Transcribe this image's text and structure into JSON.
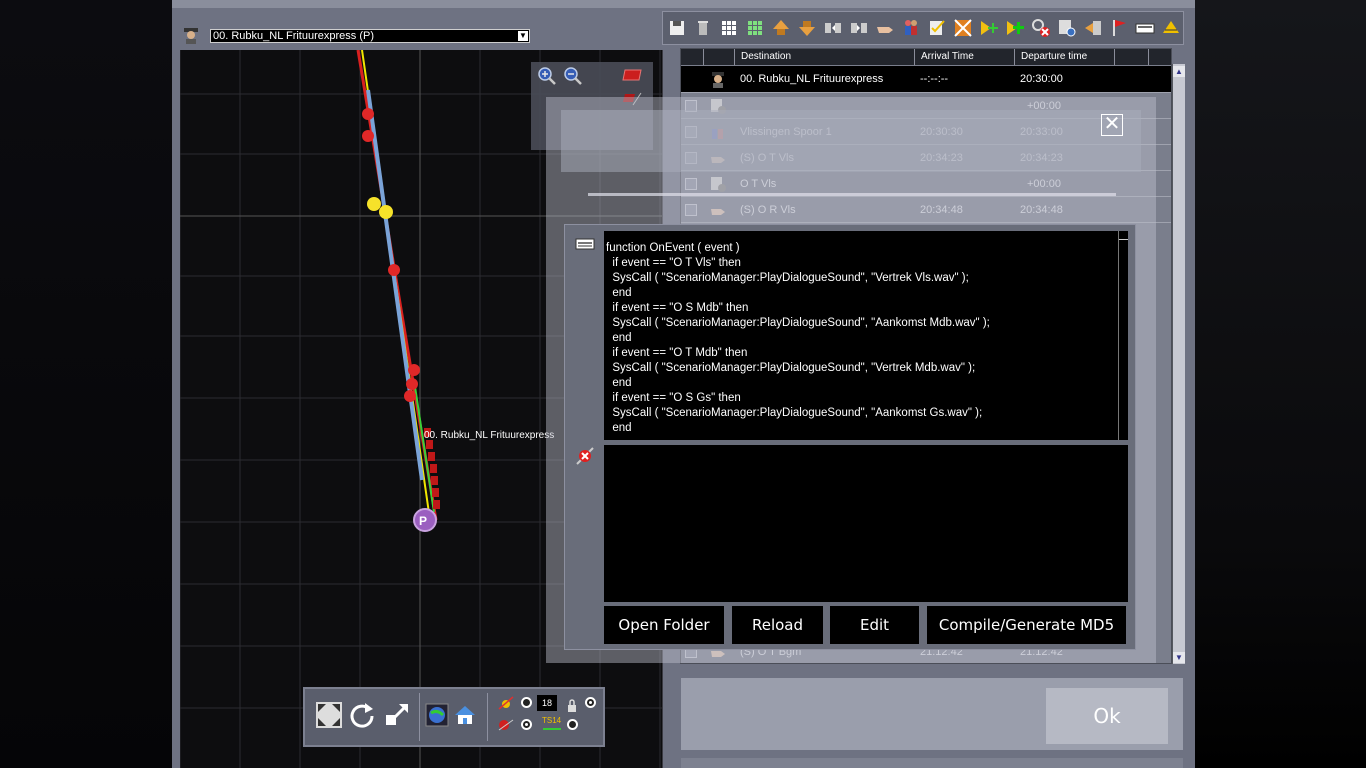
{
  "service": {
    "selected": "00. Rubku_NL Frituurexpress (P)",
    "map_label": "00. Rubku_NL Frituurexpress",
    "icon": "driver-avatar-icon"
  },
  "top_toolbar": {
    "icons": [
      "save-icon",
      "trash-icon",
      "grid-icon",
      "grid-green-icon",
      "move-up-icon",
      "move-down-icon",
      "split-icon",
      "merge-icon",
      "hand-icon",
      "people-icon",
      "checklist-icon",
      "crossing-icon",
      "add-yellow-icon",
      "add-green-icon",
      "search-cancel-icon",
      "settings-icon",
      "export-icon",
      "flag-icon",
      "keyboard-icon",
      "track-icon"
    ]
  },
  "timetable": {
    "headers": {
      "destination": "Destination",
      "arrival": "Arrival Time",
      "departure": "Departure time"
    },
    "rows": [
      {
        "icon": "driver-icon",
        "destination": "00. Rubku_NL Frituurexpress",
        "arrival": "--:--:--",
        "departure": "20:30:00"
      },
      {
        "icon": "gear-icon",
        "destination": "",
        "arrival": "",
        "departure": "+00:00"
      },
      {
        "icon": "people-icon",
        "destination": "Vlissingen Spoor 1",
        "arrival": "20:30:30",
        "departure": "20:33:00"
      },
      {
        "icon": "hand-icon",
        "destination": "(S) O T Vls",
        "arrival": "20:34:23",
        "departure": "20:34:23"
      },
      {
        "icon": "gear-icon",
        "destination": "O T Vls",
        "arrival": "",
        "departure": "+00:00"
      },
      {
        "icon": "hand-icon",
        "destination": "(S) O R Vls",
        "arrival": "20:34:48",
        "departure": "20:34:48"
      }
    ],
    "last_row": {
      "icon": "hand-icon",
      "destination": "(S) O T Bgm",
      "arrival": "21:12:42",
      "departure": "21:12:42"
    }
  },
  "script": {
    "code": "function OnEvent ( event )\n  if event == \"O T Vls\" then\n  SysCall ( \"ScenarioManager:PlayDialogueSound\", \"Vertrek Vls.wav\" );\n  end\n  if event == \"O S Mdb\" then\n  SysCall ( \"ScenarioManager:PlayDialogueSound\", \"Aankomst Mdb.wav\" );\n  end\n  if event == \"O T Mdb\" then\n  SysCall ( \"ScenarioManager:PlayDialogueSound\", \"Vertrek Mdb.wav\" );\n  end\n  if event == \"O S Gs\" then\n  SysCall ( \"ScenarioManager:PlayDialogueSound\", \"Aankomst Gs.wav\" );\n  end",
    "open_folder": "Open Folder",
    "reload": "Reload",
    "edit": "Edit",
    "compile": "Compile/Generate MD5",
    "output": ""
  },
  "ok_label": "Ok",
  "close_label": "✕",
  "bottom_toolbar": {
    "counter": "18",
    "icons": [
      "fullscreen-icon",
      "rotate-icon",
      "resize-icon",
      "globe-icon",
      "home-icon",
      "sun-icon",
      "rail-icon",
      "lock-icon",
      "ts-icon"
    ]
  },
  "colors": {
    "route_red": "#d92020",
    "route_yellow": "#f2e600",
    "route_blue": "#7aa3d8",
    "route_green": "#39d239",
    "marker_purple": "#9b5fc0",
    "editor_gray": "#6e7282"
  }
}
